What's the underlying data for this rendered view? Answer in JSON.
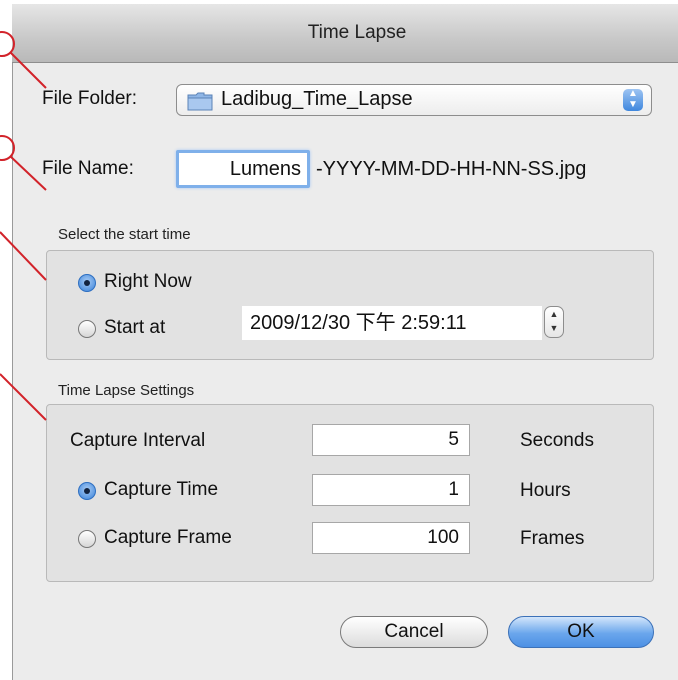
{
  "window": {
    "title": "Time Lapse"
  },
  "file_folder": {
    "label": "File Folder:",
    "value": "Ladibug_Time_Lapse",
    "icon": "folder-icon"
  },
  "file_name": {
    "label": "File Name:",
    "value": "Lumens",
    "suffix": "-YYYY-MM-DD-HH-NN-SS.jpg"
  },
  "start_group": {
    "title": "Select the start time",
    "right_now": "Right Now",
    "start_at": "Start at",
    "datetime": "2009/12/30 下午  2:59:11",
    "selected": "right_now"
  },
  "settings_group": {
    "title": "Time Lapse Settings",
    "interval_label": "Capture Interval",
    "interval_value": "5",
    "interval_unit": "Seconds",
    "time_label": "Capture Time",
    "time_value": "1",
    "time_unit": "Hours",
    "frame_label": "Capture Frame",
    "frame_value": "100",
    "frame_unit": "Frames",
    "selected": "capture_time"
  },
  "buttons": {
    "cancel": "Cancel",
    "ok": "OK"
  },
  "colors": {
    "annotation": "#d2232a",
    "accent": "#4c90e4"
  }
}
